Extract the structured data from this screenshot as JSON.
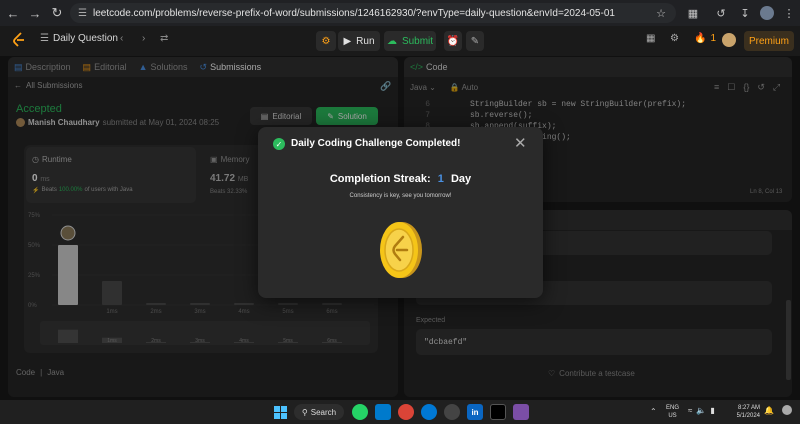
{
  "browser": {
    "url": "leetcode.com/problems/reverse-prefix-of-word/submissions/1246162930/?envType=daily-question&envId=2024-05-01"
  },
  "toolbar": {
    "problem_list_label": "Daily Question",
    "run_label": "Run",
    "submit_label": "Submit",
    "streak_count": "1",
    "premium_label": "Premium"
  },
  "left_tabs": [
    "Description",
    "Editorial",
    "Solutions",
    "Submissions"
  ],
  "submission": {
    "back_label": "All Submissions",
    "status": "Accepted",
    "author": "Manish Chaudhary",
    "submitted_text": "submitted at May 01, 2024 08:25",
    "editorial_button": "Editorial",
    "solution_button": "Solution",
    "runtime_label": "Runtime",
    "runtime_value": "0",
    "runtime_unit": "ms",
    "runtime_beats_prefix": "Beats",
    "runtime_beats_pct": "100.00%",
    "runtime_beats_suffix": "of users with Java",
    "memory_label": "Memory",
    "memory_value": "41.72",
    "memory_unit": "MB",
    "memory_beats": "Beats 32.33%",
    "code_label": "Code",
    "lang_label": "Java"
  },
  "chart_data": {
    "type": "bar",
    "categories": [
      "",
      "1ms",
      "2ms",
      "3ms",
      "4ms",
      "5ms",
      "6ms"
    ],
    "values": [
      50,
      20,
      1,
      1,
      1,
      1,
      1
    ],
    "ylabels": [
      "75%",
      "50%",
      "25%",
      "0%"
    ],
    "ylim": [
      0,
      75
    ],
    "selected_index": 0,
    "bar_color": "#4a4a4a",
    "selected_color": "#d0d0d0"
  },
  "editor": {
    "tab_label": "Code",
    "language": "Java",
    "mode": "Auto",
    "lines": [
      {
        "num": "6",
        "text": "StringBuilder sb = new StringBuilder(prefix);"
      },
      {
        "num": "7",
        "text": "sb.reverse();"
      },
      {
        "num": "8",
        "text": "sb.append(suffix);"
      },
      {
        "num": "9",
        "text": "return sb.toString();"
      }
    ],
    "cursor_pos": "Ln 8, Col 13"
  },
  "testcase": {
    "expected_label": "Expected",
    "expected_value": "\"dcbaefd\"",
    "contribute_label": "Contribute a testcase"
  },
  "modal": {
    "title": "Daily Coding Challenge Completed!",
    "streak_label": "Completion Streak:",
    "streak_value": "1",
    "streak_unit": "Day",
    "message": "Consistency is key, see you tomorrow!"
  },
  "taskbar": {
    "search_label": "Search",
    "lang_line1": "ENG",
    "lang_line2": "US",
    "time": "8:27 AM",
    "date": "5/1/2024"
  },
  "colors": {
    "accent_green": "#2cbb5d",
    "premium_orange": "#ffa116",
    "coin_gold": "#f5c518"
  }
}
